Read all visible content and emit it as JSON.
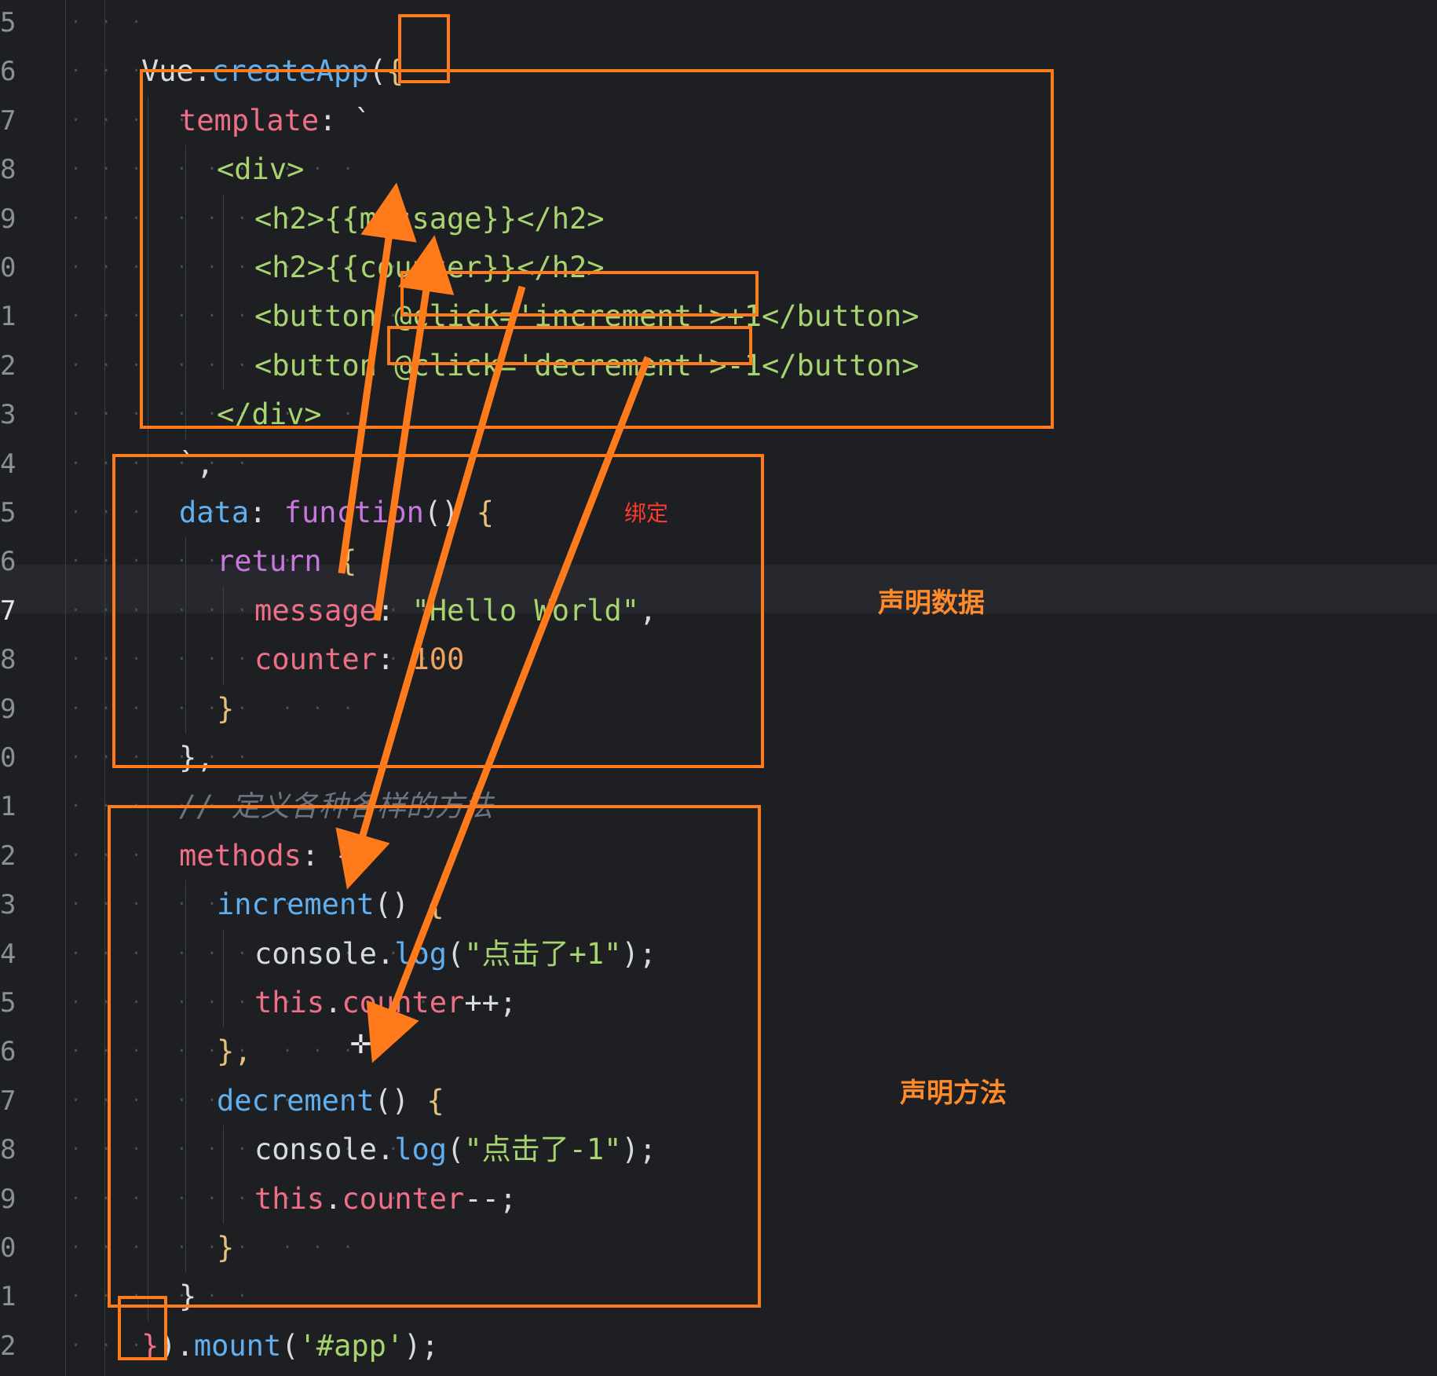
{
  "line_numbers": [
    "5",
    "6",
    "7",
    "8",
    "9",
    "0",
    "1",
    "2",
    "3",
    "4",
    "5",
    "6",
    "7",
    "8",
    "9",
    "0",
    "1",
    "2",
    "3",
    "4",
    "5",
    "6",
    "7",
    "8",
    "9",
    "0",
    "1",
    "2"
  ],
  "code_lines": [
    [],
    [
      {
        "t": "Vue.",
        "c": "c-plain"
      },
      {
        "t": "createApp",
        "c": "c-fn"
      },
      {
        "t": "(",
        "c": "c-plain"
      },
      {
        "t": "{",
        "c": "c-br"
      }
    ],
    [
      {
        "t": "template",
        "c": "c-key"
      },
      {
        "t": ": `",
        "c": "c-plain"
      }
    ],
    [
      {
        "t": "<div>",
        "c": "c-tag"
      }
    ],
    [
      {
        "t": "<h2>{{message}}</h2>",
        "c": "c-tag"
      }
    ],
    [
      {
        "t": "<h2>{{counter}}</h2>",
        "c": "c-tag"
      }
    ],
    [
      {
        "t": "<button @click='increment'>+1</button>",
        "c": "c-tag"
      }
    ],
    [
      {
        "t": "<button @click='decrement'>-1</button>",
        "c": "c-tag"
      }
    ],
    [
      {
        "t": "</div>",
        "c": "c-tag"
      }
    ],
    [
      {
        "t": "`,",
        "c": "c-plain"
      }
    ],
    [
      {
        "t": "data",
        "c": "c-fn"
      },
      {
        "t": ": ",
        "c": "c-plain"
      },
      {
        "t": "function",
        "c": "c-kw"
      },
      {
        "t": "() ",
        "c": "c-plain"
      },
      {
        "t": "{",
        "c": "c-br"
      }
    ],
    [
      {
        "t": "return ",
        "c": "c-kw"
      },
      {
        "t": "{",
        "c": "c-br"
      }
    ],
    [
      {
        "t": "message",
        "c": "c-key"
      },
      {
        "t": ": ",
        "c": "c-plain"
      },
      {
        "t": "\"Hello World\"",
        "c": "c-str"
      },
      {
        "t": ",",
        "c": "c-plain"
      }
    ],
    [
      {
        "t": "counter",
        "c": "c-key"
      },
      {
        "t": ": ",
        "c": "c-plain"
      },
      {
        "t": "100",
        "c": "c-num"
      }
    ],
    [
      {
        "t": "}",
        "c": "c-br"
      }
    ],
    [
      {
        "t": "},",
        "c": "c-plain"
      }
    ],
    [
      {
        "t": "// 定义各种各样的方法",
        "c": "c-cm"
      }
    ],
    [
      {
        "t": "methods",
        "c": "c-key"
      },
      {
        "t": ": {",
        "c": "c-plain"
      }
    ],
    [
      {
        "t": "increment",
        "c": "c-fn"
      },
      {
        "t": "() ",
        "c": "c-plain"
      },
      {
        "t": "{",
        "c": "c-br"
      }
    ],
    [
      {
        "t": "console.",
        "c": "c-plain"
      },
      {
        "t": "log",
        "c": "c-fn"
      },
      {
        "t": "(",
        "c": "c-plain"
      },
      {
        "t": "\"点击了+1\"",
        "c": "c-str"
      },
      {
        "t": ");",
        "c": "c-plain"
      }
    ],
    [
      {
        "t": "this",
        "c": "c-key"
      },
      {
        "t": ".",
        "c": "c-plain"
      },
      {
        "t": "counter",
        "c": "c-key"
      },
      {
        "t": "++;",
        "c": "c-plain"
      }
    ],
    [
      {
        "t": "},",
        "c": "c-br"
      }
    ],
    [
      {
        "t": "decrement",
        "c": "c-fn"
      },
      {
        "t": "() ",
        "c": "c-plain"
      },
      {
        "t": "{",
        "c": "c-br"
      }
    ],
    [
      {
        "t": "console.",
        "c": "c-plain"
      },
      {
        "t": "log",
        "c": "c-fn"
      },
      {
        "t": "(",
        "c": "c-plain"
      },
      {
        "t": "\"点击了-1\"",
        "c": "c-str"
      },
      {
        "t": ");",
        "c": "c-plain"
      }
    ],
    [
      {
        "t": "this",
        "c": "c-key"
      },
      {
        "t": ".",
        "c": "c-plain"
      },
      {
        "t": "counter",
        "c": "c-key"
      },
      {
        "t": "--;",
        "c": "c-plain"
      }
    ],
    [
      {
        "t": "}",
        "c": "c-br"
      }
    ],
    [
      {
        "t": "}",
        "c": "c-plain"
      }
    ],
    [
      {
        "t": "}",
        "c": "c-key"
      },
      {
        "t": ").",
        "c": "c-plain"
      },
      {
        "t": "mount",
        "c": "c-fn"
      },
      {
        "t": "(",
        "c": "c-plain"
      },
      {
        "t": "'#app'",
        "c": "c-str"
      },
      {
        "t": ");",
        "c": "c-plain"
      }
    ]
  ],
  "annotations": {
    "binding": "绑定",
    "declare_data": "声明数据",
    "declare_methods": "声明方法"
  },
  "colors": {
    "accent": "#ff7a1a",
    "background": "#1e1f22"
  }
}
